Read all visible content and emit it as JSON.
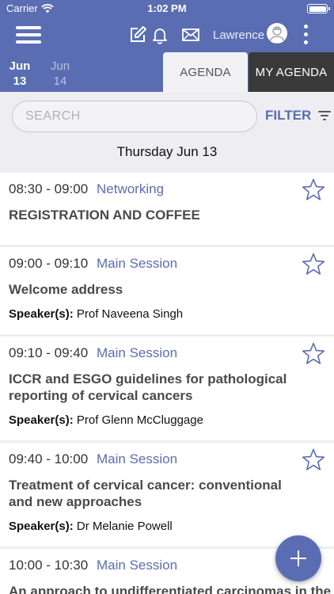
{
  "status_bar": {
    "carrier": "Carrier",
    "time": "1:02 PM"
  },
  "nav": {
    "user_name": "Lawrence"
  },
  "days": [
    {
      "month": "Jun",
      "day": "13",
      "active": true
    },
    {
      "month": "Jun",
      "day": "14",
      "active": false
    }
  ],
  "tabs": {
    "agenda": "AGENDA",
    "my_agenda": "MY AGENDA"
  },
  "search": {
    "placeholder": "SEARCH",
    "filter_label": "FILTER"
  },
  "day_heading": "Thursday Jun 13",
  "sessions": [
    {
      "time": "08:30 - 09:00",
      "track": "Networking",
      "title": "REGISTRATION AND COFFEE",
      "speaker_label": "",
      "speaker": ""
    },
    {
      "time": "09:00 - 09:10",
      "track": "Main Session",
      "title": "Welcome address",
      "speaker_label": "Speaker(s):",
      "speaker": "Prof Naveena Singh"
    },
    {
      "time": "09:10 - 09:40",
      "track": "Main Session",
      "title": "ICCR and ESGO guidelines for pathological reporting of cervical cancers",
      "speaker_label": "Speaker(s):",
      "speaker": "Prof Glenn McCluggage"
    },
    {
      "time": "09:40 - 10:00",
      "track": "Main Session",
      "title": "Treatment of cervical cancer: conventional and new approaches",
      "speaker_label": "Speaker(s):",
      "speaker": "Dr Melanie Powell"
    },
    {
      "time": "10:00 - 10:30",
      "track": "Main Session",
      "title": "An approach to undifferentiated carcinomas in the",
      "speaker_label": "",
      "speaker": ""
    }
  ],
  "colors": {
    "brand": "#5a6db3",
    "tab_dark": "#3a3a3a",
    "background": "#eeeef2"
  },
  "icons": [
    "hamburger-menu-icon",
    "compose-icon",
    "bell-icon",
    "mail-icon",
    "avatar-icon",
    "more-vertical-icon",
    "filter-icon",
    "star-outline-icon",
    "plus-icon",
    "wifi-icon",
    "battery-icon"
  ]
}
